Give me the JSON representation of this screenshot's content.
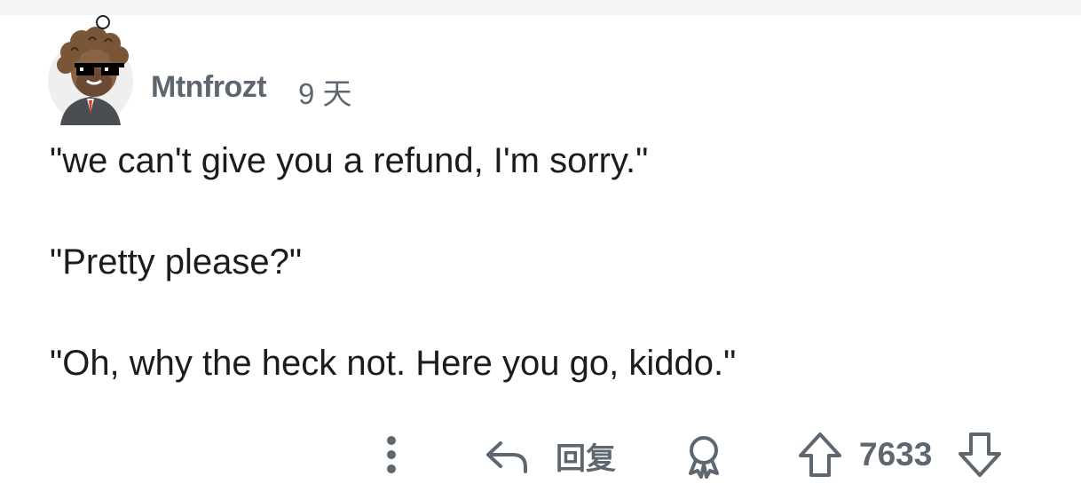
{
  "comment": {
    "author": "Mtnfrozt",
    "time": "9 天",
    "paragraphs": [
      "\"we can't give you a refund, I'm sorry.\"",
      "\"Pretty please?\"",
      "\"Oh, why the heck not. Here you go, kiddo.\""
    ]
  },
  "actions": {
    "more_icon": "vertical-dots-icon",
    "reply_icon": "reply-arrow-icon",
    "reply_label": "回复",
    "award_icon": "award-icon",
    "upvote_icon": "upvote-arrow-icon",
    "score": "7633",
    "downvote_icon": "downvote-arrow-icon"
  },
  "colors": {
    "text": "#1c1c1c",
    "meta": "#5e6670",
    "background": "#ffffff",
    "top_strip": "#f3f4f6"
  }
}
